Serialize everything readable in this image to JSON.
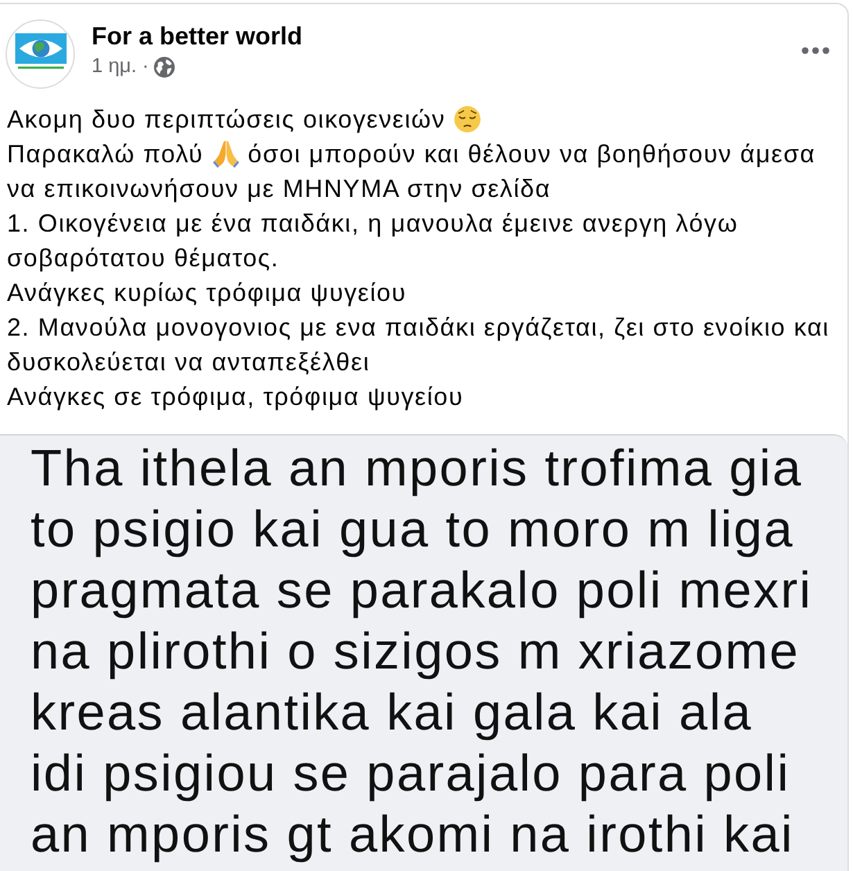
{
  "post": {
    "page_name": "For a better world",
    "time": "1 ημ.",
    "separator": "·",
    "public": true,
    "paragraphs": [
      {
        "parts": [
          {
            "kind": "text",
            "text": "Ακομη δυο περιπτώσεις οικογενειών"
          },
          {
            "kind": "pensive"
          }
        ]
      },
      {
        "parts": [
          {
            "kind": "text",
            "text": "Παρακαλώ πολύ"
          },
          {
            "kind": "pray"
          },
          {
            "kind": "text",
            "text": "όσοι μπορούν και θέλουν να βοηθήσουν άμεσα να επικοινωνήσουν με ΜΗΝΥΜΑ στην σελίδα"
          }
        ]
      },
      {
        "parts": [
          {
            "kind": "text",
            "text": "1. Οικογένεια με ένα παιδάκι, η μανουλα έμεινε ανεργη λόγω σοβαρότατου θέματος."
          }
        ]
      },
      {
        "parts": [
          {
            "kind": "text",
            "text": "Ανάγκες κυρίως τρόφιμα ψυγείου"
          }
        ]
      },
      {
        "parts": [
          {
            "kind": "text",
            "text": "2. Μανούλα μονογονιος με ενα παιδάκι εργάζεται, ζει στο ενοίκιο και δυσκολεύεται να ανταπεξέλθει"
          }
        ]
      },
      {
        "parts": [
          {
            "kind": "text",
            "text": "Ανάγκες σε τρόφιμα, τρόφιμα ψυγείου"
          }
        ]
      }
    ],
    "image": {
      "text": "Tha ithela an mporis trofima gia\nto psigio kai gua to moro m liga\npragmata se parakalo poli mexri\nna plirothi o sizigos m xriazome\nkreas alantika kai gala kai ala\nidi psigiou se parajalo para poli\nan mporis gt akomi na irothi kai"
    }
  }
}
